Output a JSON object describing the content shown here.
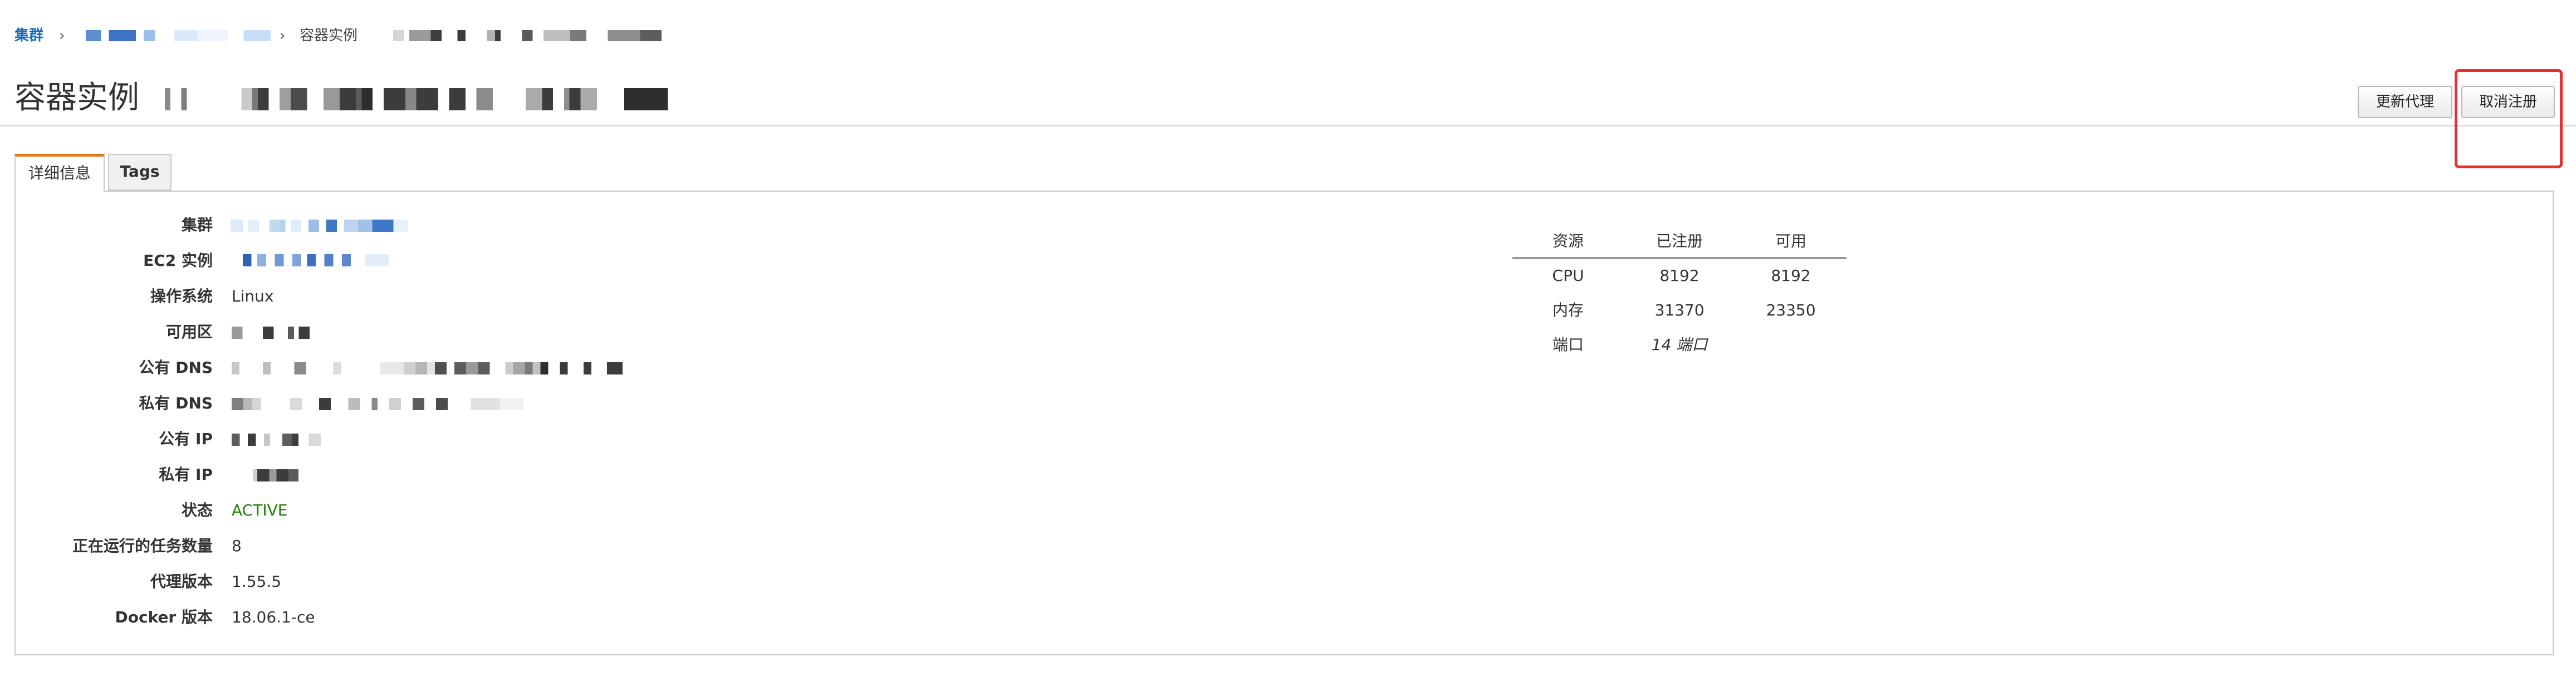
{
  "breadcrumb": {
    "cluster_link": "集群",
    "separator": "›",
    "current_label": "容器实例"
  },
  "page": {
    "title": "容器实例"
  },
  "toolbar": {
    "update_agent_label": "更新代理",
    "deregister_label": "取消注册"
  },
  "tabs": [
    {
      "label": "详细信息",
      "active": true
    },
    {
      "label": "Tags",
      "active": false
    }
  ],
  "details": {
    "cluster_label": "集群",
    "ec2_instance_label": "EC2 实例",
    "os_label": "操作系统",
    "os_value": "Linux",
    "az_label": "可用区",
    "public_dns_label": "公有 DNS",
    "private_dns_label": "私有 DNS",
    "public_ip_label": "公有 IP",
    "private_ip_label": "私有 IP",
    "status_label": "状态",
    "status_value": "ACTIVE",
    "running_tasks_label": "正在运行的任务数量",
    "running_tasks_value": "8",
    "agent_version_label": "代理版本",
    "agent_version_value": "1.55.5",
    "docker_version_label": "Docker 版本",
    "docker_version_value": "18.06.1-ce"
  },
  "resources": {
    "headers": [
      "资源",
      "已注册",
      "可用"
    ],
    "rows": [
      [
        "CPU",
        "8192",
        "8192"
      ],
      [
        "内存",
        "31370",
        "23350"
      ],
      [
        "端口",
        "14 端口",
        ""
      ]
    ]
  },
  "colors": {
    "link": "#1a6bb5",
    "active_tab_accent": "#e47911",
    "status_active": "#1d8102",
    "annotation": "#e5302f"
  }
}
